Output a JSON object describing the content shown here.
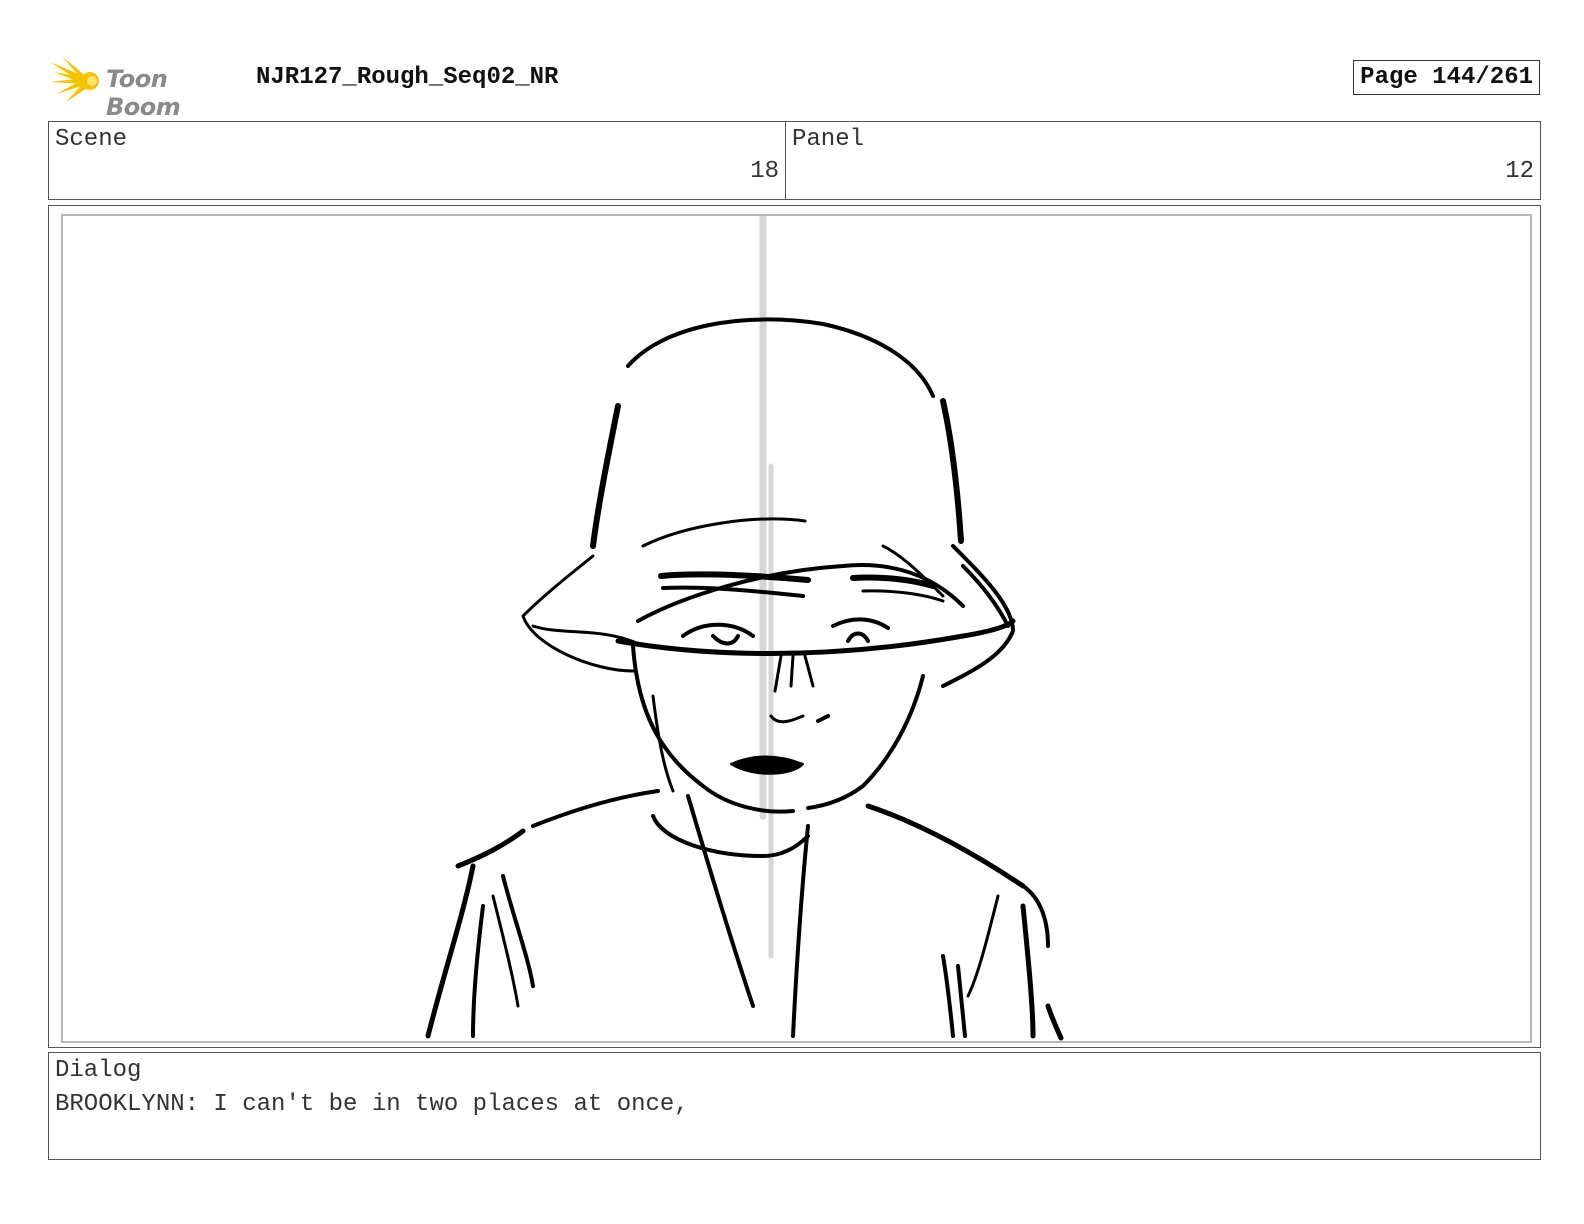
{
  "header": {
    "logo_text": "Toon Boom",
    "project_title": "NJR127_Rough_Seq02_NR",
    "page_label": "Page 144/261"
  },
  "info": {
    "scene_label": "Scene",
    "scene_value": "18",
    "panel_label": "Panel",
    "panel_value": "12"
  },
  "dialog": {
    "label": "Dialog",
    "text": "BROOKLYNN: I can't be in two places at once,"
  },
  "colors": {
    "logo_sun": "#f5c400",
    "ink": "#000000",
    "frame_border": "#b8b8b8"
  }
}
